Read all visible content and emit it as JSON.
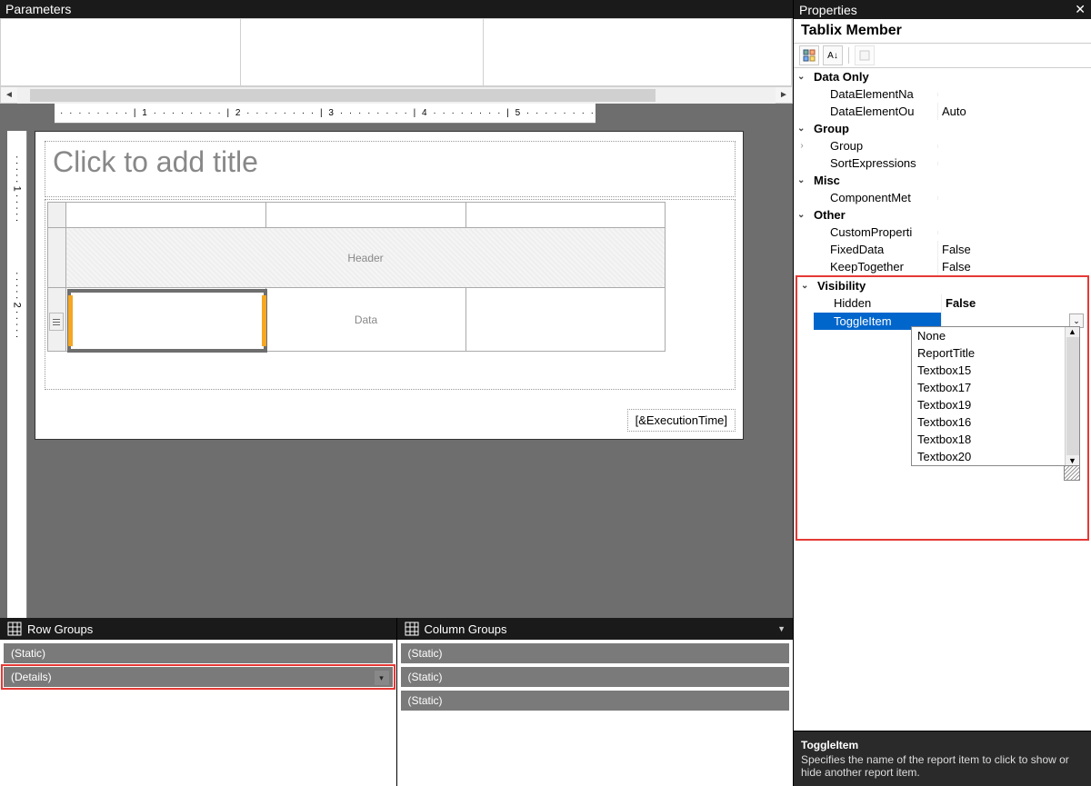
{
  "parameters": {
    "title": "Parameters"
  },
  "ruler": {
    "marks": [
      "1",
      "2",
      "3",
      "4",
      "5"
    ]
  },
  "report": {
    "title_placeholder": "Click to add title",
    "header_label": "Header",
    "data_label": "Data",
    "execution_time": "[&ExecutionTime]"
  },
  "rowGroups": {
    "title": "Row Groups",
    "items": [
      "(Static)",
      "(Details)"
    ],
    "selected_index": 1
  },
  "colGroups": {
    "title": "Column Groups",
    "items": [
      "(Static)",
      "(Static)",
      "(Static)"
    ]
  },
  "properties": {
    "title": "Properties",
    "object": "Tablix Member",
    "categories": [
      {
        "name": "Data Only",
        "expanded": true,
        "rows": [
          {
            "name": "DataElementName",
            "displayName": "DataElementNa",
            "value": ""
          },
          {
            "name": "DataElementOutput",
            "displayName": "DataElementOu",
            "value": "Auto"
          }
        ]
      },
      {
        "name": "Group",
        "expanded": true,
        "rows": [
          {
            "name": "Group",
            "displayName": "Group",
            "value": "",
            "expandable": true
          },
          {
            "name": "SortExpressions",
            "displayName": "SortExpressions",
            "value": ""
          }
        ]
      },
      {
        "name": "Misc",
        "expanded": true,
        "rows": [
          {
            "name": "ComponentMetadata",
            "displayName": "ComponentMet",
            "value": ""
          }
        ]
      },
      {
        "name": "Other",
        "expanded": true,
        "rows": [
          {
            "name": "CustomProperties",
            "displayName": "CustomProperti",
            "value": ""
          },
          {
            "name": "FixedData",
            "displayName": "FixedData",
            "value": "False"
          },
          {
            "name": "KeepTogether",
            "displayName": "KeepTogether",
            "value": "False"
          }
        ]
      },
      {
        "name": "Visibility",
        "expanded": true,
        "highlight": true,
        "rows": [
          {
            "name": "Hidden",
            "displayName": "Hidden",
            "value": "False",
            "bold": true
          },
          {
            "name": "ToggleItem",
            "displayName": "ToggleItem",
            "value": "",
            "selected": true,
            "dropdown": true
          }
        ]
      }
    ],
    "toggle_options": [
      "None",
      "ReportTitle",
      "Textbox15",
      "Textbox17",
      "Textbox19",
      "Textbox16",
      "Textbox18",
      "Textbox20"
    ],
    "description": {
      "name": "ToggleItem",
      "text": "Specifies the name of the report item to click to show or hide another report item."
    }
  }
}
